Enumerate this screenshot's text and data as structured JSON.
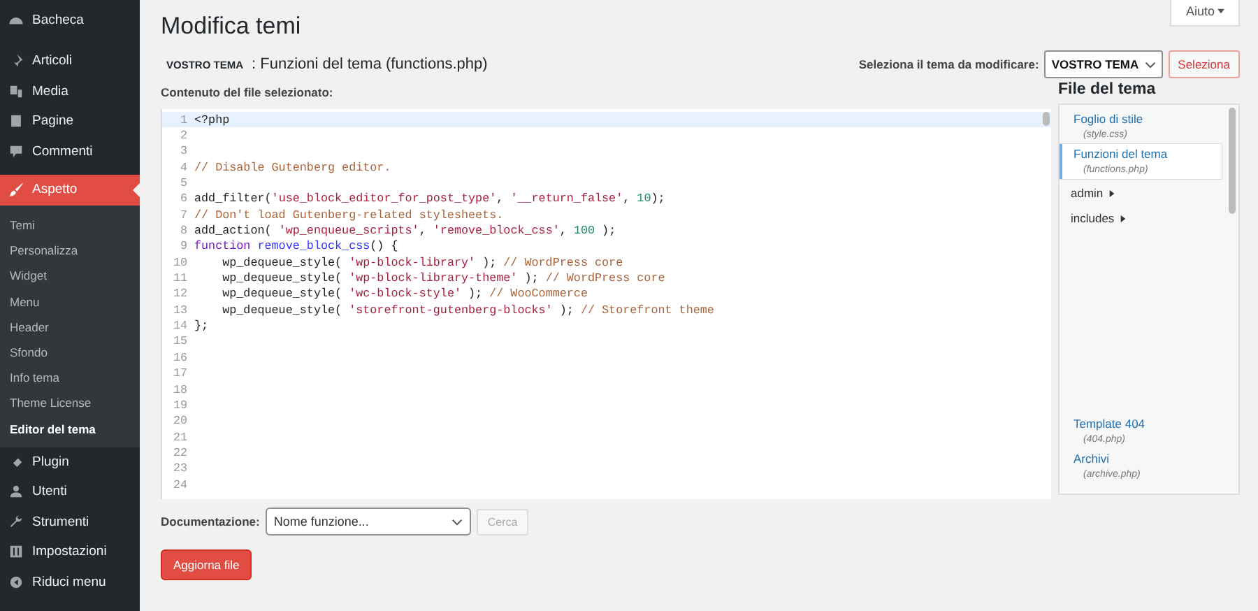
{
  "sidebar": {
    "items": [
      {
        "label": "Bacheca",
        "selected": false
      },
      {
        "label": "Articoli",
        "selected": false
      },
      {
        "label": "Media",
        "selected": false
      },
      {
        "label": "Pagine",
        "selected": false
      },
      {
        "label": "Commenti",
        "selected": false
      },
      {
        "label": "Aspetto",
        "selected": true,
        "children": [
          {
            "label": "Temi",
            "selected": false
          },
          {
            "label": "Personalizza",
            "selected": false
          },
          {
            "label": "Widget",
            "selected": false
          },
          {
            "label": "Menu",
            "selected": false
          },
          {
            "label": "Header",
            "selected": false
          },
          {
            "label": "Sfondo",
            "selected": false
          },
          {
            "label": "Info tema",
            "selected": false
          },
          {
            "label": "Theme License",
            "selected": false
          },
          {
            "label": "Editor del tema",
            "selected": true
          }
        ]
      },
      {
        "label": "Plugin",
        "selected": false
      },
      {
        "label": "Utenti",
        "selected": false
      },
      {
        "label": "Strumenti",
        "selected": false
      },
      {
        "label": "Impostazioni",
        "selected": false
      },
      {
        "label": "Riduci menu",
        "selected": false
      }
    ]
  },
  "help_button": "Aiuto",
  "page_title": "Modifica temi",
  "file_heading": {
    "theme": "VOSTRO TEMA",
    "file": ": Funzioni del tema (functions.php)"
  },
  "theme_select": {
    "label": "Seleziona il tema da modificare:",
    "value": "VOSTRO TEMA",
    "button": "Seleziona"
  },
  "editor": {
    "label": "Contenuto del file selezionato:",
    "lines": [
      {
        "number": "1",
        "tokens": [
          {
            "kind": "plain",
            "text": "<?php"
          }
        ]
      },
      {
        "number": "2"
      },
      {
        "number": "3"
      },
      {
        "number": "4",
        "tokens": [
          {
            "kind": "comment",
            "text": "// Disable Gutenberg editor."
          }
        ]
      },
      {
        "number": "5"
      },
      {
        "number": "6",
        "tokens": [
          {
            "kind": "plain",
            "text": "add_filter("
          },
          {
            "kind": "string",
            "text": "'use_block_editor_for_post_type'"
          },
          {
            "kind": "plain",
            "text": ", "
          },
          {
            "kind": "string",
            "text": "'__return_false'"
          },
          {
            "kind": "plain",
            "text": ", "
          },
          {
            "kind": "number",
            "text": "10"
          },
          {
            "kind": "plain",
            "text": ");"
          }
        ]
      },
      {
        "number": "7",
        "tokens": [
          {
            "kind": "comment",
            "text": "// Don't load Gutenberg-related stylesheets."
          }
        ]
      },
      {
        "number": "8",
        "tokens": [
          {
            "kind": "plain",
            "text": "add_action( "
          },
          {
            "kind": "string",
            "text": "'wp_enqueue_scripts'"
          },
          {
            "kind": "plain",
            "text": ", "
          },
          {
            "kind": "string",
            "text": "'remove_block_css'"
          },
          {
            "kind": "plain",
            "text": ", "
          },
          {
            "kind": "number",
            "text": "100"
          },
          {
            "kind": "plain",
            "text": " );"
          }
        ]
      },
      {
        "number": "9",
        "tokens": [
          {
            "kind": "keyword",
            "text": "function"
          },
          {
            "kind": "func",
            "text": "remove_block_css"
          },
          {
            "kind": "plain",
            "text": "() {"
          }
        ]
      },
      {
        "number": "10",
        "tokens": [
          {
            "kind": "plain",
            "text": "    wp_dequeue_style( "
          },
          {
            "kind": "string",
            "text": "'wp-block-library'"
          },
          {
            "kind": "plain",
            "text": " ); "
          },
          {
            "kind": "comment",
            "text": "// WordPress core"
          }
        ]
      },
      {
        "number": "11",
        "tokens": [
          {
            "kind": "plain",
            "text": "    wp_dequeue_style( "
          },
          {
            "kind": "string",
            "text": "'wp-block-library-theme'"
          },
          {
            "kind": "plain",
            "text": " ); "
          },
          {
            "kind": "comment",
            "text": "// WordPress core"
          }
        ]
      },
      {
        "number": "12",
        "tokens": [
          {
            "kind": "plain",
            "text": "    wp_dequeue_style( "
          },
          {
            "kind": "string",
            "text": "'wc-block-style'"
          },
          {
            "kind": "plain",
            "text": " ); "
          },
          {
            "kind": "comment",
            "text": "// WooCommerce"
          }
        ]
      },
      {
        "number": "13",
        "tokens": [
          {
            "kind": "plain",
            "text": "    wp_dequeue_style( "
          },
          {
            "kind": "string",
            "text": "'storefront-gutenberg-blocks'"
          },
          {
            "kind": "plain",
            "text": " ); "
          },
          {
            "kind": "comment",
            "text": "// Storefront theme"
          }
        ]
      },
      {
        "number": "14",
        "tokens": [
          {
            "kind": "plain",
            "text": "};"
          }
        ]
      },
      {
        "number": "15"
      },
      {
        "number": "16"
      },
      {
        "number": "17"
      },
      {
        "number": "18"
      },
      {
        "number": "19"
      },
      {
        "number": "20"
      },
      {
        "number": "21"
      },
      {
        "number": "22"
      },
      {
        "number": "23"
      },
      {
        "number": "24"
      }
    ]
  },
  "files": {
    "title": "File del tema",
    "items": [
      {
        "kind": "file",
        "label": "Foglio di stile",
        "filename": "(style.css)",
        "selected": false
      },
      {
        "kind": "file",
        "label": "Funzioni del tema",
        "filename": "(functions.php)",
        "selected": true
      },
      {
        "kind": "folder",
        "label": "admin",
        "expanded": false
      },
      {
        "kind": "folder",
        "label": "includes",
        "expanded": false
      },
      {
        "kind": "gap"
      },
      {
        "kind": "file",
        "label": "Template 404",
        "filename": "(404.php)",
        "selected": false
      },
      {
        "kind": "file",
        "label": "Archivi",
        "filename": "(archive.php)",
        "selected": false
      }
    ]
  },
  "documentation": {
    "label": "Documentazione:",
    "placeholder": "Nome funzione...",
    "button": "Cerca"
  },
  "update_button": "Aggiorna file"
}
